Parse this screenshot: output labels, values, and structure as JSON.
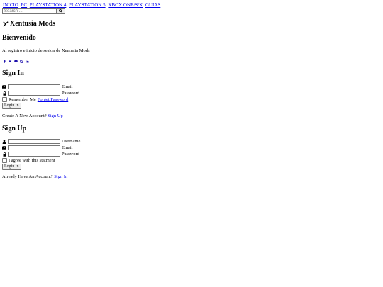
{
  "nav": {
    "items": [
      "INICIO",
      "PC",
      "PLAYSTATION 4",
      "PLAYSTATION 5",
      "XBOX ONE/S/X",
      "GUIAS"
    ]
  },
  "search": {
    "placeholder": "Search ..."
  },
  "site": {
    "name": "Xentusia Mods"
  },
  "welcome": {
    "title": "Bienvenido",
    "subtitle": "Al registro e inicio de sesion de Xentusia Mods"
  },
  "social": [
    "facebook-icon",
    "twitter-icon",
    "youtube-icon",
    "instagram-icon",
    "linkedin-icon"
  ],
  "signin": {
    "title": "Sign In",
    "email_label": "Email",
    "password_label": "Password",
    "remember_label": "Remember Me",
    "forget_link": "Forget Password",
    "button": "Login in",
    "create_prompt": "Create A New Account?",
    "signup_link": "Sign Up"
  },
  "signup": {
    "title": "Sign Up",
    "username_label": "Username",
    "email_label": "Email",
    "password_label": "Password",
    "agree_label": "I agree with this statment",
    "button": "Login in",
    "have_prompt": "Already Have An Account?",
    "signin_link": "Sign In"
  }
}
